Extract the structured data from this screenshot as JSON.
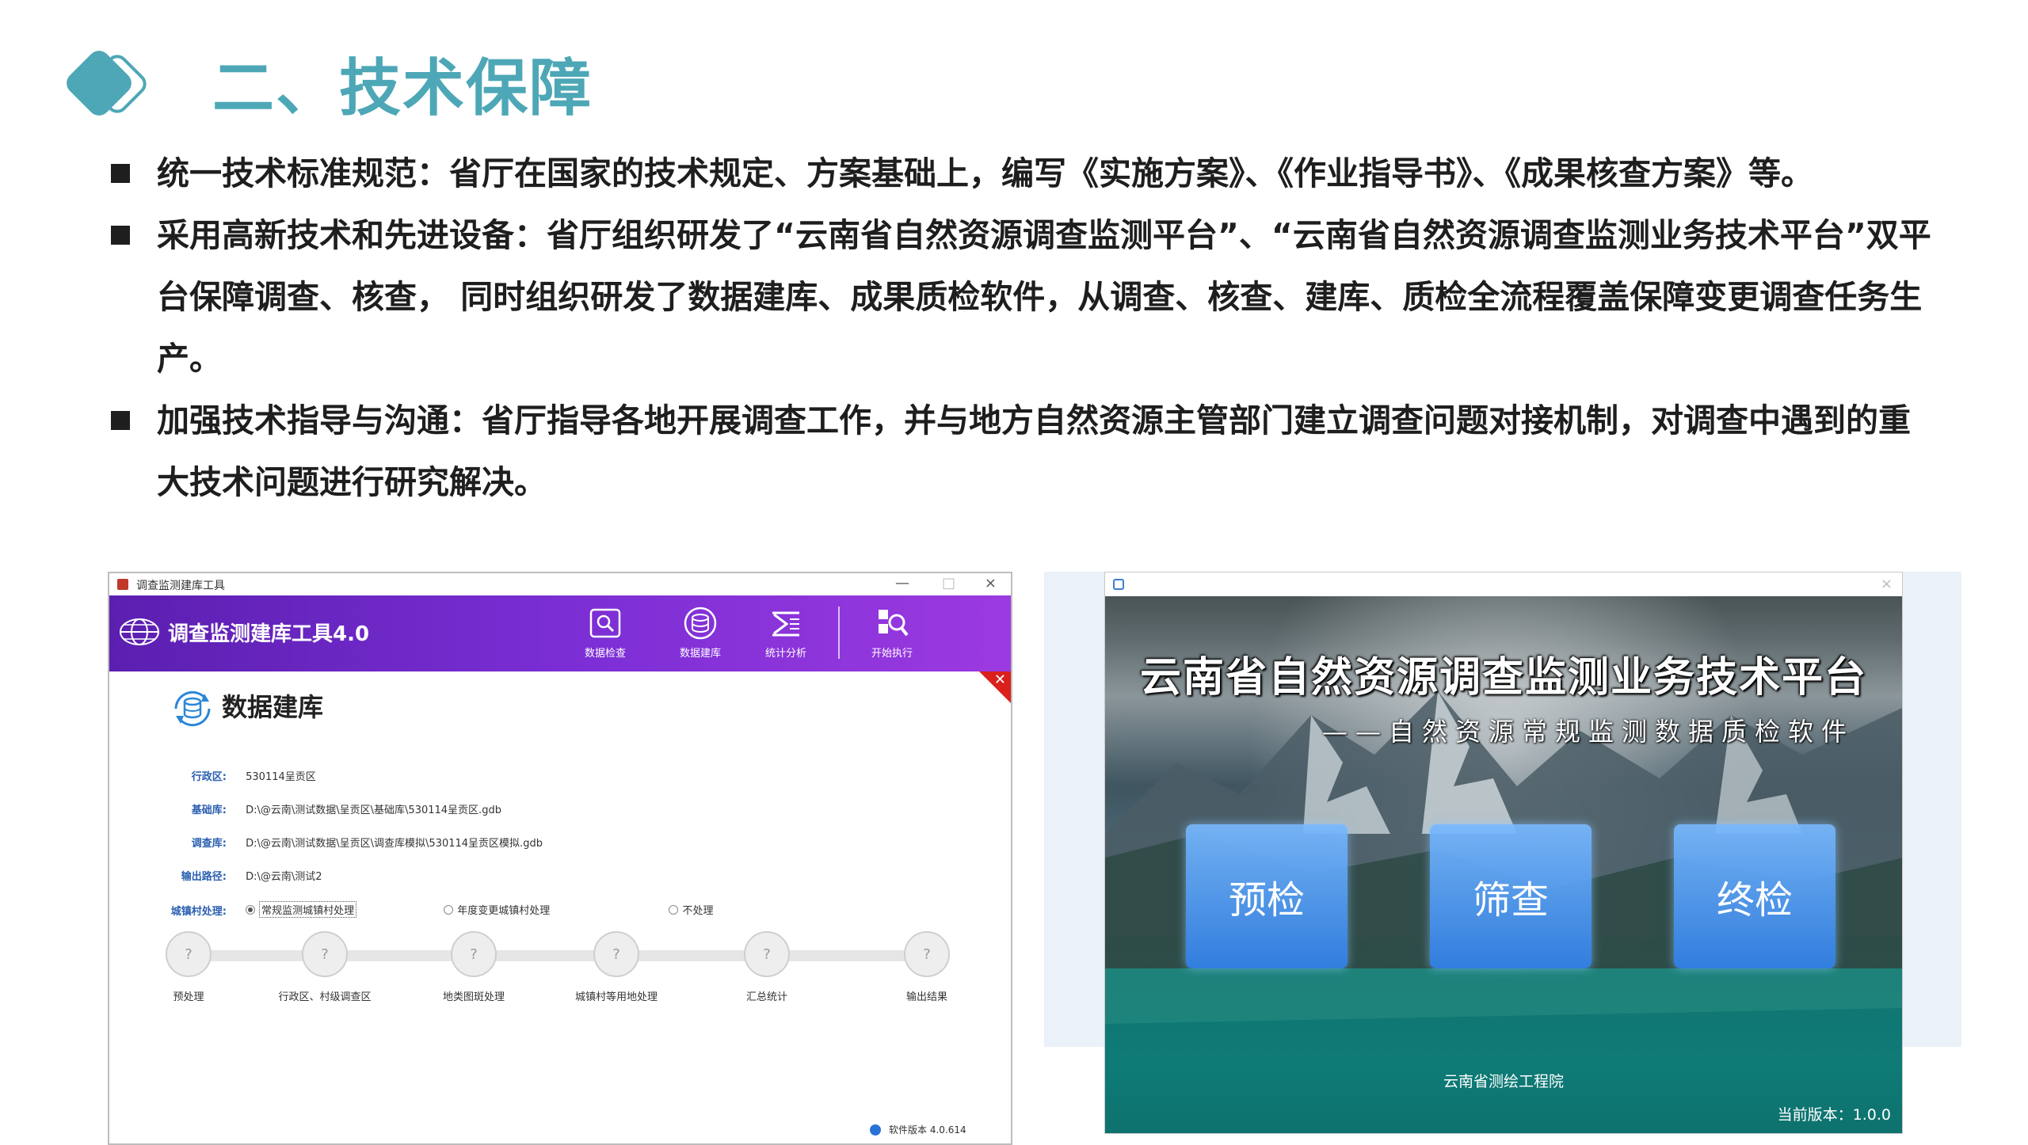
{
  "slide": {
    "title": "二、技术保障",
    "bullets": [
      {
        "text": "统一技术标准规范：省厅在国家的技术规定、方案基础上，编写《实施方案》、《作业指导书》、《成果核查方案》等。"
      },
      {
        "text": "采用高新技术和先进设备：省厅组织研发了“云南省自然资源调查监测平台”、“云南省自然资源调查监测业务技术平台”双平台保障调查、核查， 同时组织研发了数据建库、成果质检软件，从调查、核查、建库、质检全流程覆盖保障变更调查任务生产。"
      },
      {
        "text": "加强技术指导与沟通：省厅指导各地开展调查工作，并与地方自然资源主管部门建立调查问题对接机制，对调查中遇到的重大技术问题进行研究解决。"
      }
    ]
  },
  "left_window": {
    "window_title": "调查监测建库工具",
    "controls": {
      "minimize": "—",
      "maximize": "□",
      "close": "×"
    },
    "app_name": "调查监测建库工具4.0",
    "toolbar": [
      {
        "label": "数据检查",
        "icon": "data-check-icon"
      },
      {
        "label": "数据建库",
        "icon": "database-icon"
      },
      {
        "label": "统计分析",
        "icon": "statistics-icon"
      },
      {
        "label": "开始执行",
        "icon": "run-icon"
      }
    ],
    "panel_title": "数据建库",
    "fields": [
      {
        "label": "行政区:",
        "value": "530114呈贡区"
      },
      {
        "label": "基础库:",
        "value": "D:\\@云南\\测试数据\\呈贡区\\基础库\\530114呈贡区.gdb"
      },
      {
        "label": "调查库:",
        "value": "D:\\@云南\\测试数据\\呈贡区\\调查库模拟\\530114呈贡区模拟.gdb"
      },
      {
        "label": "输出路径:",
        "value": "D:\\@云南\\测试2"
      }
    ],
    "urban_processing": {
      "label": "城镇村处理:",
      "options": [
        {
          "label": "常规监测城镇村处理",
          "selected": true
        },
        {
          "label": "年度变更城镇村处理",
          "selected": false
        },
        {
          "label": "不处理",
          "selected": false
        }
      ]
    },
    "steps": [
      {
        "symbol": "?",
        "label": "预处理"
      },
      {
        "symbol": "?",
        "label": "行政区、村级调查区"
      },
      {
        "symbol": "?",
        "label": "地类图斑处理"
      },
      {
        "symbol": "?",
        "label": "城镇村等用地处理"
      },
      {
        "symbol": "?",
        "label": "汇总统计"
      },
      {
        "symbol": "?",
        "label": "输出结果"
      }
    ],
    "close_corner": "✕",
    "version": "软件版本 4.0.614"
  },
  "right_window": {
    "close": "×",
    "title": "云南省自然资源调查监测业务技术平台",
    "subtitle": "——自然资源常规监测数据质检软件",
    "buttons": [
      "预检",
      "筛查",
      "终检"
    ],
    "organization": "云南省测绘工程院",
    "version": "当前版本：1.0.0"
  },
  "colors": {
    "title_teal": "#4da7b6",
    "banner_purple": "#7a2ed4",
    "button_blue": "#4a9ef0"
  }
}
